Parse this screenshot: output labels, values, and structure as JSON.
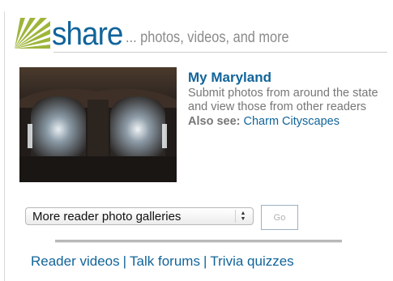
{
  "header": {
    "brand": "share",
    "tagline": "... photos, videos, and more",
    "logo_icon": "sunburst-logo-icon",
    "accent_color": "#11649a"
  },
  "feature": {
    "image_icon": "bridge-underpass-photo",
    "title": "My Maryland",
    "description": "Submit photos from around the state and view those from other readers",
    "also_label": "Also see:",
    "also_link": "Charm Cityscapes"
  },
  "gallery_select": {
    "selected": "More reader photo galleries",
    "go_label": "Go"
  },
  "footer": {
    "links": [
      "Reader videos",
      "Talk forums",
      "Trivia quizzes"
    ],
    "separator": "|"
  }
}
